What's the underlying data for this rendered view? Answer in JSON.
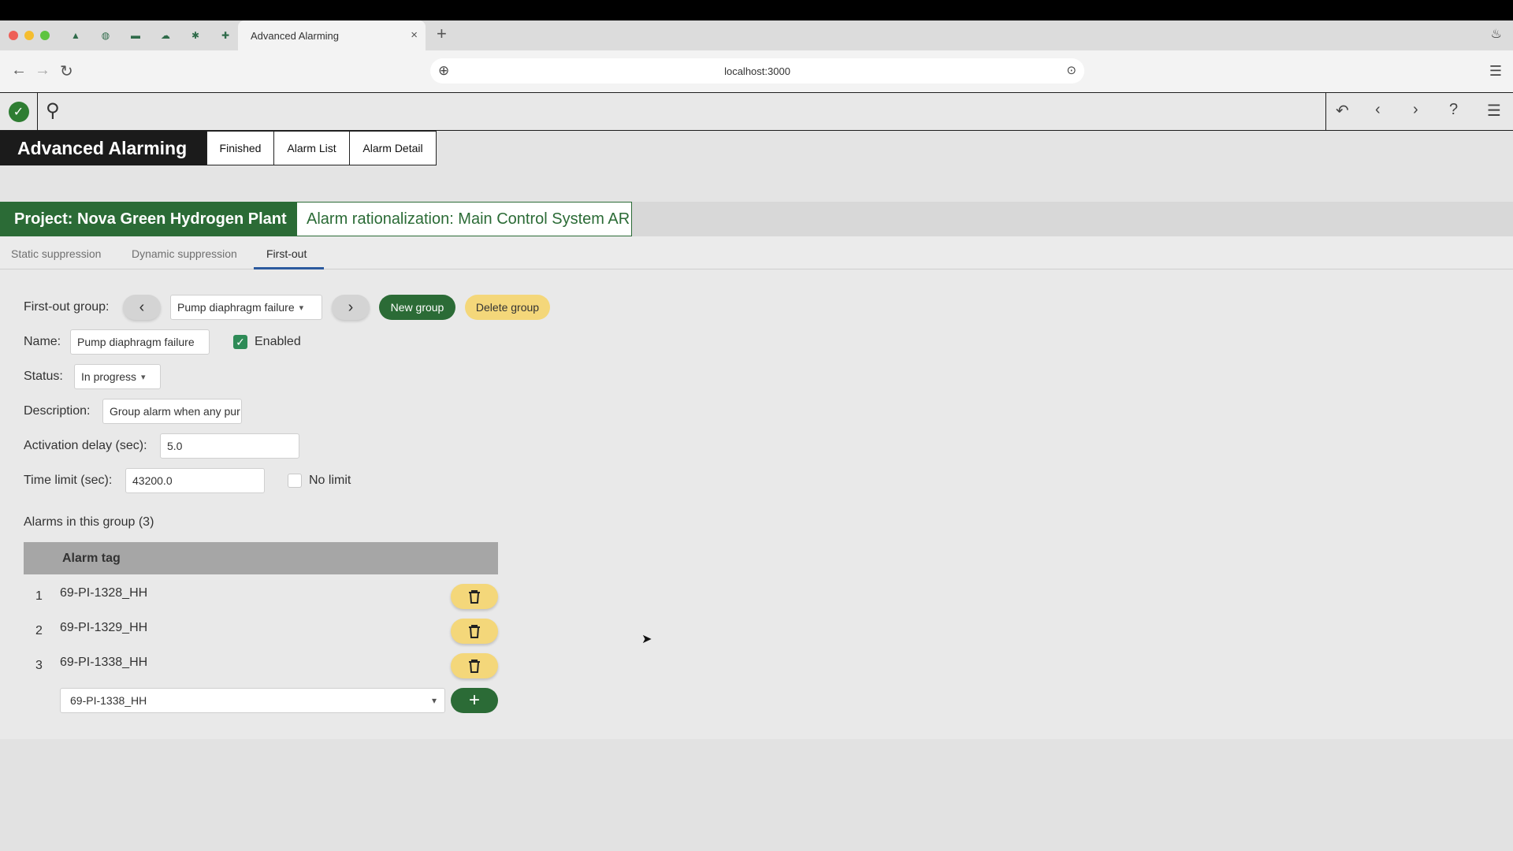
{
  "browser": {
    "tab_title": "Advanced Alarming",
    "url": "localhost:3000",
    "new_tab": "+",
    "tab_close": "×"
  },
  "app": {
    "title": "Advanced Alarming",
    "top_tabs": [
      "Finished",
      "Alarm List",
      "Alarm Detail"
    ],
    "project": "Project: Nova Green Hydrogen Plant",
    "rationalization": "Alarm rationalization: Main Control System AR",
    "sub_tabs": [
      "Static suppression",
      "Dynamic suppression",
      "First-out"
    ],
    "active_sub_tab": "First-out"
  },
  "form": {
    "group_label": "First-out group:",
    "group_value": "Pump diaphragm failure",
    "new_group": "New group",
    "delete_group": "Delete group",
    "name_label": "Name:",
    "name_value": "Pump diaphragm failure",
    "enabled_label": "Enabled",
    "enabled": true,
    "status_label": "Status:",
    "status_value": "In progress",
    "description_label": "Description:",
    "description_value": "Group alarm when any pur",
    "delay_label": "Activation delay (sec):",
    "delay_value": "5.0",
    "time_limit_label": "Time limit (sec):",
    "time_limit_value": "43200.0",
    "no_limit_label": "No limit",
    "no_limit": false
  },
  "alarms": {
    "heading": "Alarms in this group (3)",
    "column_header": "Alarm tag",
    "rows": [
      {
        "num": "1",
        "tag": "69-PI-1328_HH"
      },
      {
        "num": "2",
        "tag": "69-PI-1329_HH"
      },
      {
        "num": "3",
        "tag": "69-PI-1338_HH"
      }
    ],
    "add_select_value": "69-PI-1338_HH",
    "add_button": "+"
  },
  "colors": {
    "brand_green": "#2b6b36",
    "accent_yellow": "#f4d77a",
    "tab_underline": "#2c5a9e"
  }
}
